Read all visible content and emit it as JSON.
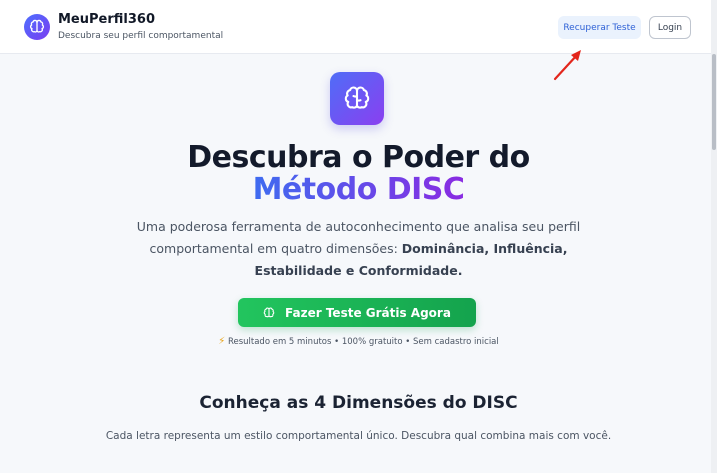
{
  "header": {
    "brand": "MeuPerfil360",
    "tagline": "Descubra seu perfil comportamental",
    "recover_label": "Recuperar Teste",
    "login_label": "Login"
  },
  "hero": {
    "title_line1": "Descubra o Poder do",
    "title_line2": "Método DISC",
    "desc_part1": "Uma poderosa ferramenta de autoconhecimento que analisa seu perfil comportamental em quatro dimensões: ",
    "desc_bold": "Dominância, Influência, Estabilidade e Conformidade.",
    "cta_label": "Fazer Teste Grátis Agora",
    "note": "Resultado em 5 minutos • 100% gratuito • Sem cadastro inicial"
  },
  "section": {
    "title": "Conheça as 4 Dimensões do DISC",
    "subtitle": "Cada letra representa um estilo comportamental único. Descubra qual combina mais com você."
  },
  "icons": {
    "logo": "brain-icon",
    "hero": "brain-icon",
    "cta": "brain-icon",
    "note": "lightning-icon"
  },
  "colors": {
    "accent_blue": "#3e6cf0",
    "accent_purple": "#8a2be2",
    "cta_green": "#22c55e",
    "annotation_red": "#e3261c"
  }
}
